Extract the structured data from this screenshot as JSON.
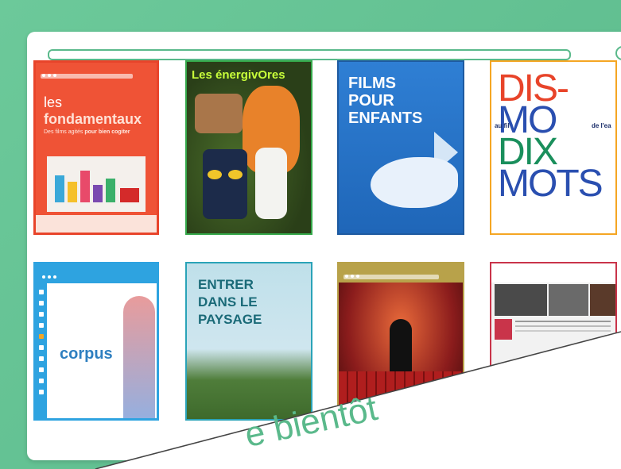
{
  "search": {
    "placeholder": ""
  },
  "tiles": [
    {
      "name": "les-fondamentaux",
      "title_prefix": "les ",
      "title_bold": "fondamentaux",
      "subtitle_prefix": "Des films agités ",
      "subtitle_bold": "pour bien cogiter"
    },
    {
      "name": "les-energivores",
      "title": "Les énergivOres"
    },
    {
      "name": "films-pour-enfants",
      "title_lines": [
        "FILMS",
        "POUR",
        "ENFANTS"
      ]
    },
    {
      "name": "dis-moi-dix-mots",
      "text_lines": [
        "DIS-",
        "MO",
        "DIX",
        "MOTS"
      ],
      "small_1": "au fil",
      "small_2": "de l'ea"
    },
    {
      "name": "corpus",
      "title": "corpus"
    },
    {
      "name": "entrer-dans-le-paysage",
      "title_lines": [
        "ENTRER",
        "DANS LE",
        "PAYSAGE"
      ]
    },
    {
      "name": "theatre",
      "title": ""
    },
    {
      "name": "news",
      "title": ""
    }
  ],
  "banner": {
    "text": "e bientôt"
  },
  "colors": {
    "accent": "#5ab98b",
    "background": "#6cc99a"
  }
}
